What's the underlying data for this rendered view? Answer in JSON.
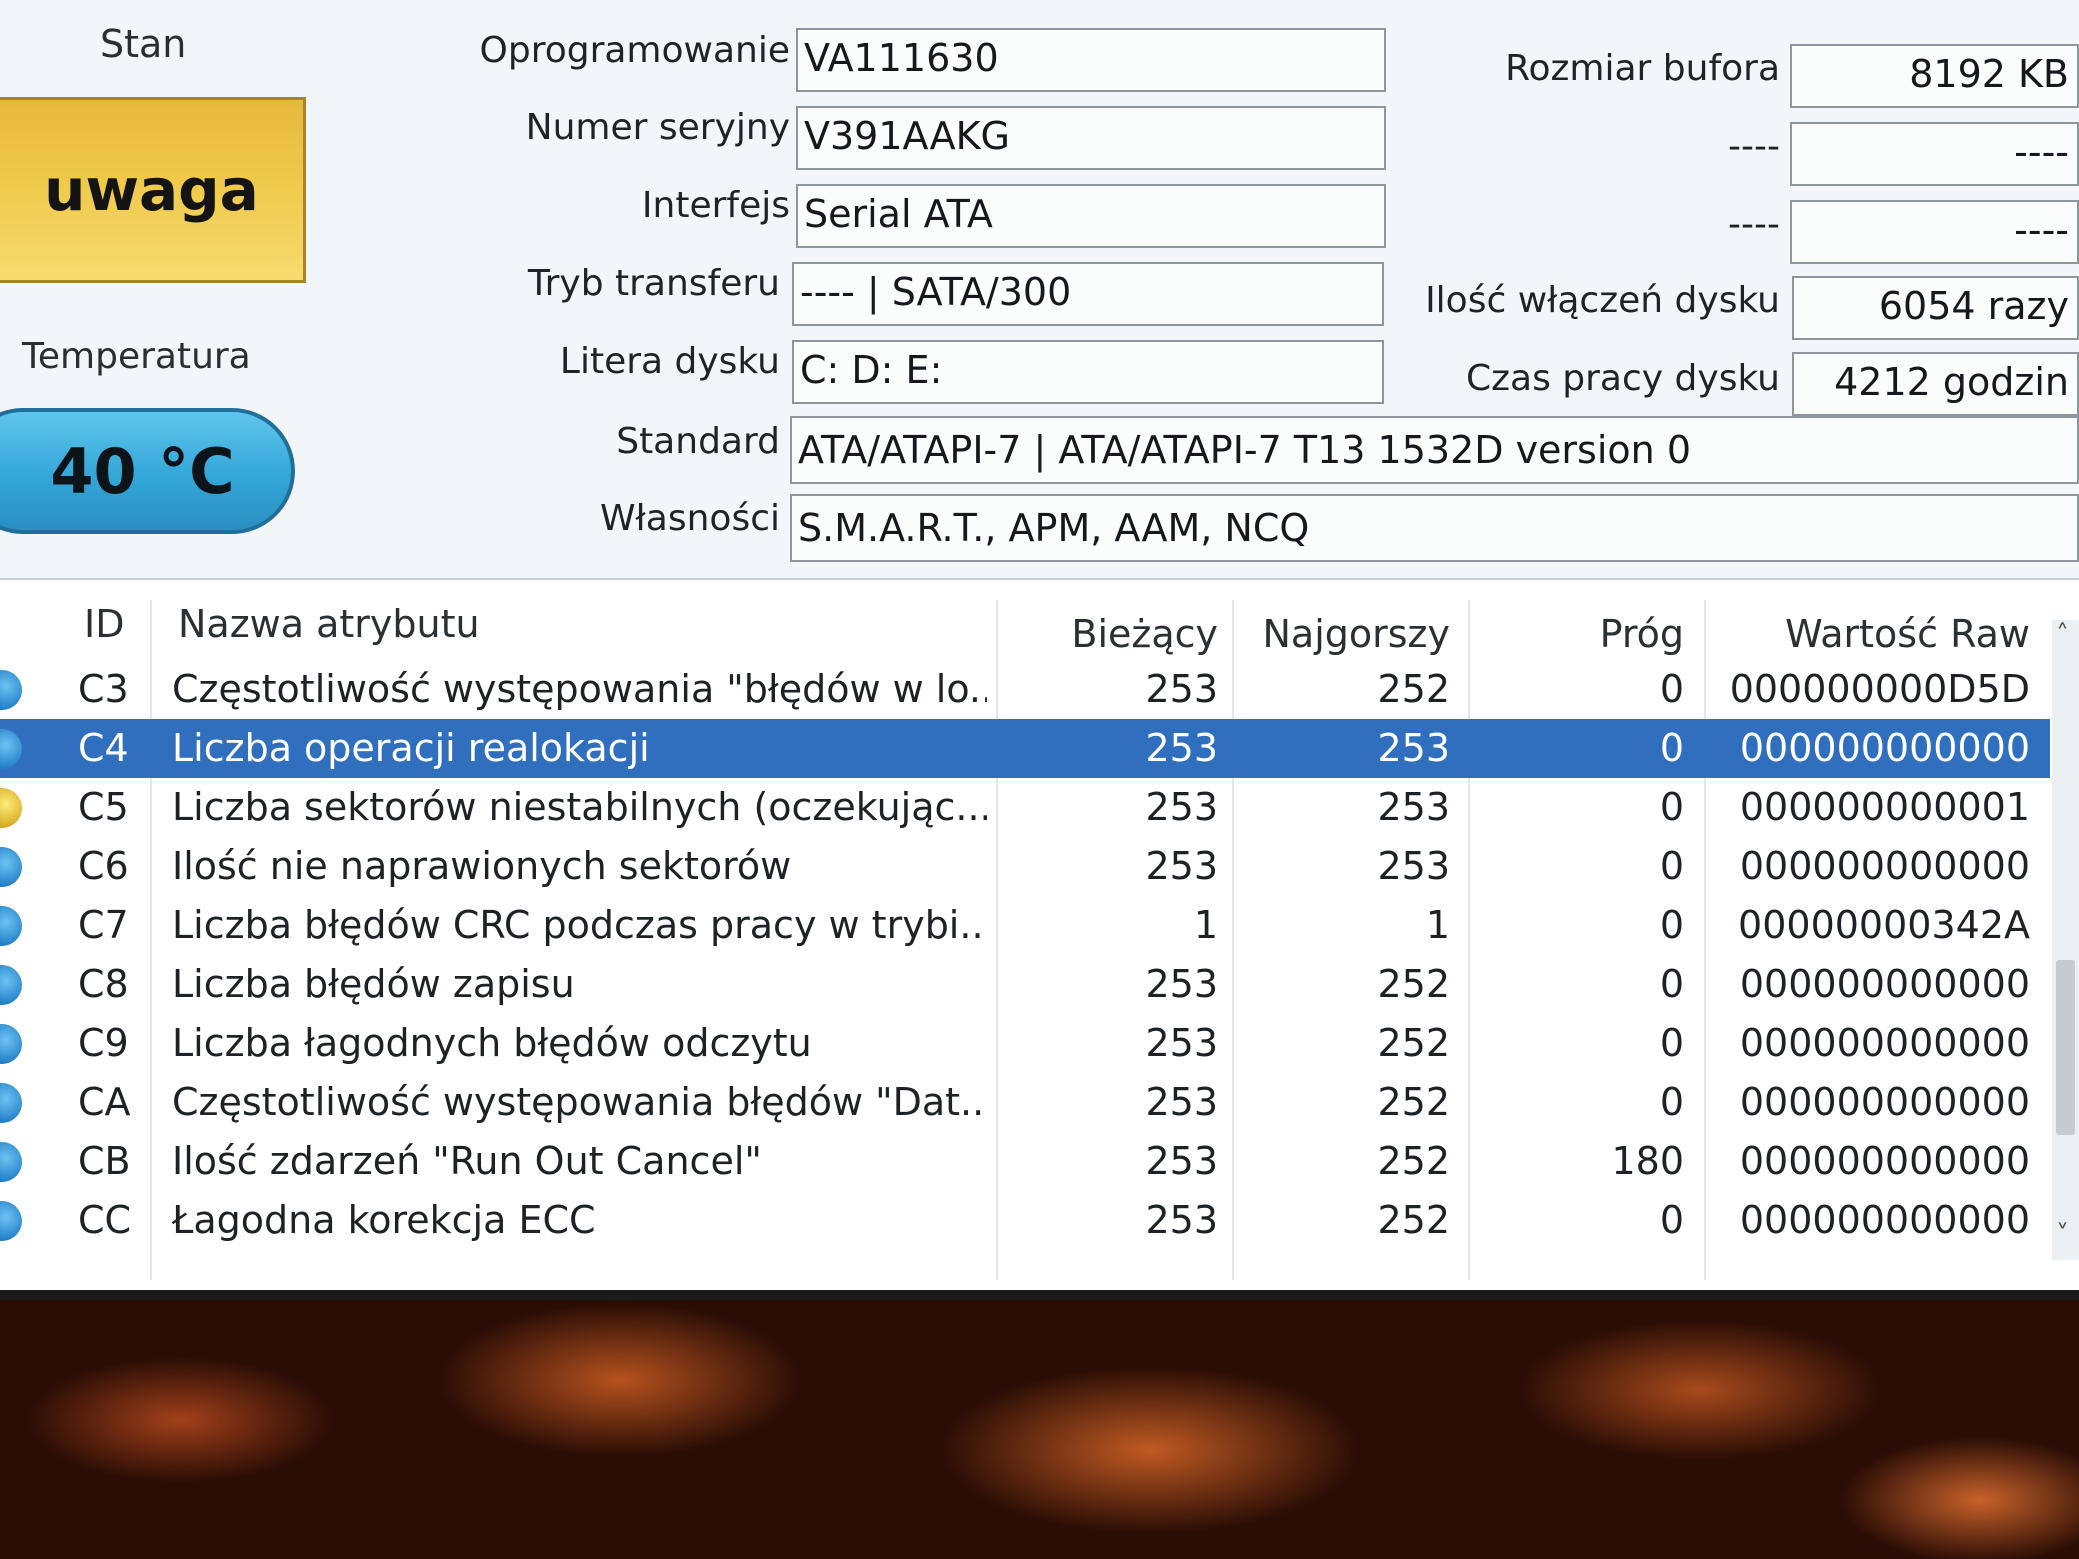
{
  "status": {
    "label": "Stan",
    "value": "uwaga",
    "color": "#efc94a"
  },
  "temperature": {
    "label": "Temperatura",
    "value": "40 °C",
    "color": "#33a6d8"
  },
  "info_left": [
    {
      "label": "Oprogramowanie",
      "value": "VA111630"
    },
    {
      "label": "Numer seryjny",
      "value": "V391AAKG"
    },
    {
      "label": "Interfejs",
      "value": "Serial ATA"
    },
    {
      "label": "Tryb transferu",
      "value": "---- | SATA/300"
    },
    {
      "label": "Litera dysku",
      "value": "C: D: E:"
    }
  ],
  "info_wide": [
    {
      "label": "Standard",
      "value": "ATA/ATAPI-7 | ATA/ATAPI-7 T13 1532D version 0"
    },
    {
      "label": "Własności",
      "value": "S.M.A.R.T., APM, AAM, NCQ"
    }
  ],
  "info_right": [
    {
      "label": "Rozmiar bufora",
      "value": "8192 KB"
    },
    {
      "label": "----",
      "value": "----"
    },
    {
      "label": "----",
      "value": "----"
    },
    {
      "label": "Ilość włączeń dysku",
      "value": "6054 razy"
    },
    {
      "label": "Czas pracy dysku",
      "value": "4212 godzin"
    }
  ],
  "table": {
    "headers": [
      "ID",
      "Nazwa atrybutu",
      "Bieżący",
      "Najgorszy",
      "Próg",
      "Wartość Raw"
    ],
    "selected_index": 1,
    "rows": [
      {
        "status": "blue",
        "id": "C3",
        "name": "Częstotliwość występowania \"błędów w lo...",
        "current": "253",
        "worst": "252",
        "threshold": "0",
        "raw": "000000000D5D"
      },
      {
        "status": "blue",
        "id": "C4",
        "name": "Liczba operacji realokacji",
        "current": "253",
        "worst": "253",
        "threshold": "0",
        "raw": "000000000000"
      },
      {
        "status": "yellow",
        "id": "C5",
        "name": "Liczba sektorów niestabilnych (oczekując...",
        "current": "253",
        "worst": "253",
        "threshold": "0",
        "raw": "000000000001"
      },
      {
        "status": "blue",
        "id": "C6",
        "name": "Ilość nie naprawionych sektorów",
        "current": "253",
        "worst": "253",
        "threshold": "0",
        "raw": "000000000000"
      },
      {
        "status": "blue",
        "id": "C7",
        "name": "Liczba błędów CRC podczas pracy w trybi...",
        "current": "1",
        "worst": "1",
        "threshold": "0",
        "raw": "00000000342A"
      },
      {
        "status": "blue",
        "id": "C8",
        "name": "Liczba błędów zapisu",
        "current": "253",
        "worst": "252",
        "threshold": "0",
        "raw": "000000000000"
      },
      {
        "status": "blue",
        "id": "C9",
        "name": "Liczba łagodnych błędów odczytu",
        "current": "253",
        "worst": "252",
        "threshold": "0",
        "raw": "000000000000"
      },
      {
        "status": "blue",
        "id": "CA",
        "name": "Częstotliwość występowania błędów \"Dat...",
        "current": "253",
        "worst": "252",
        "threshold": "0",
        "raw": "000000000000"
      },
      {
        "status": "blue",
        "id": "CB",
        "name": "Ilość zdarzeń \"Run Out Cancel\"",
        "current": "253",
        "worst": "252",
        "threshold": "180",
        "raw": "000000000000"
      },
      {
        "status": "blue",
        "id": "CC",
        "name": "Łagodna korekcja ECC",
        "current": "253",
        "worst": "252",
        "threshold": "0",
        "raw": "000000000000"
      }
    ]
  }
}
